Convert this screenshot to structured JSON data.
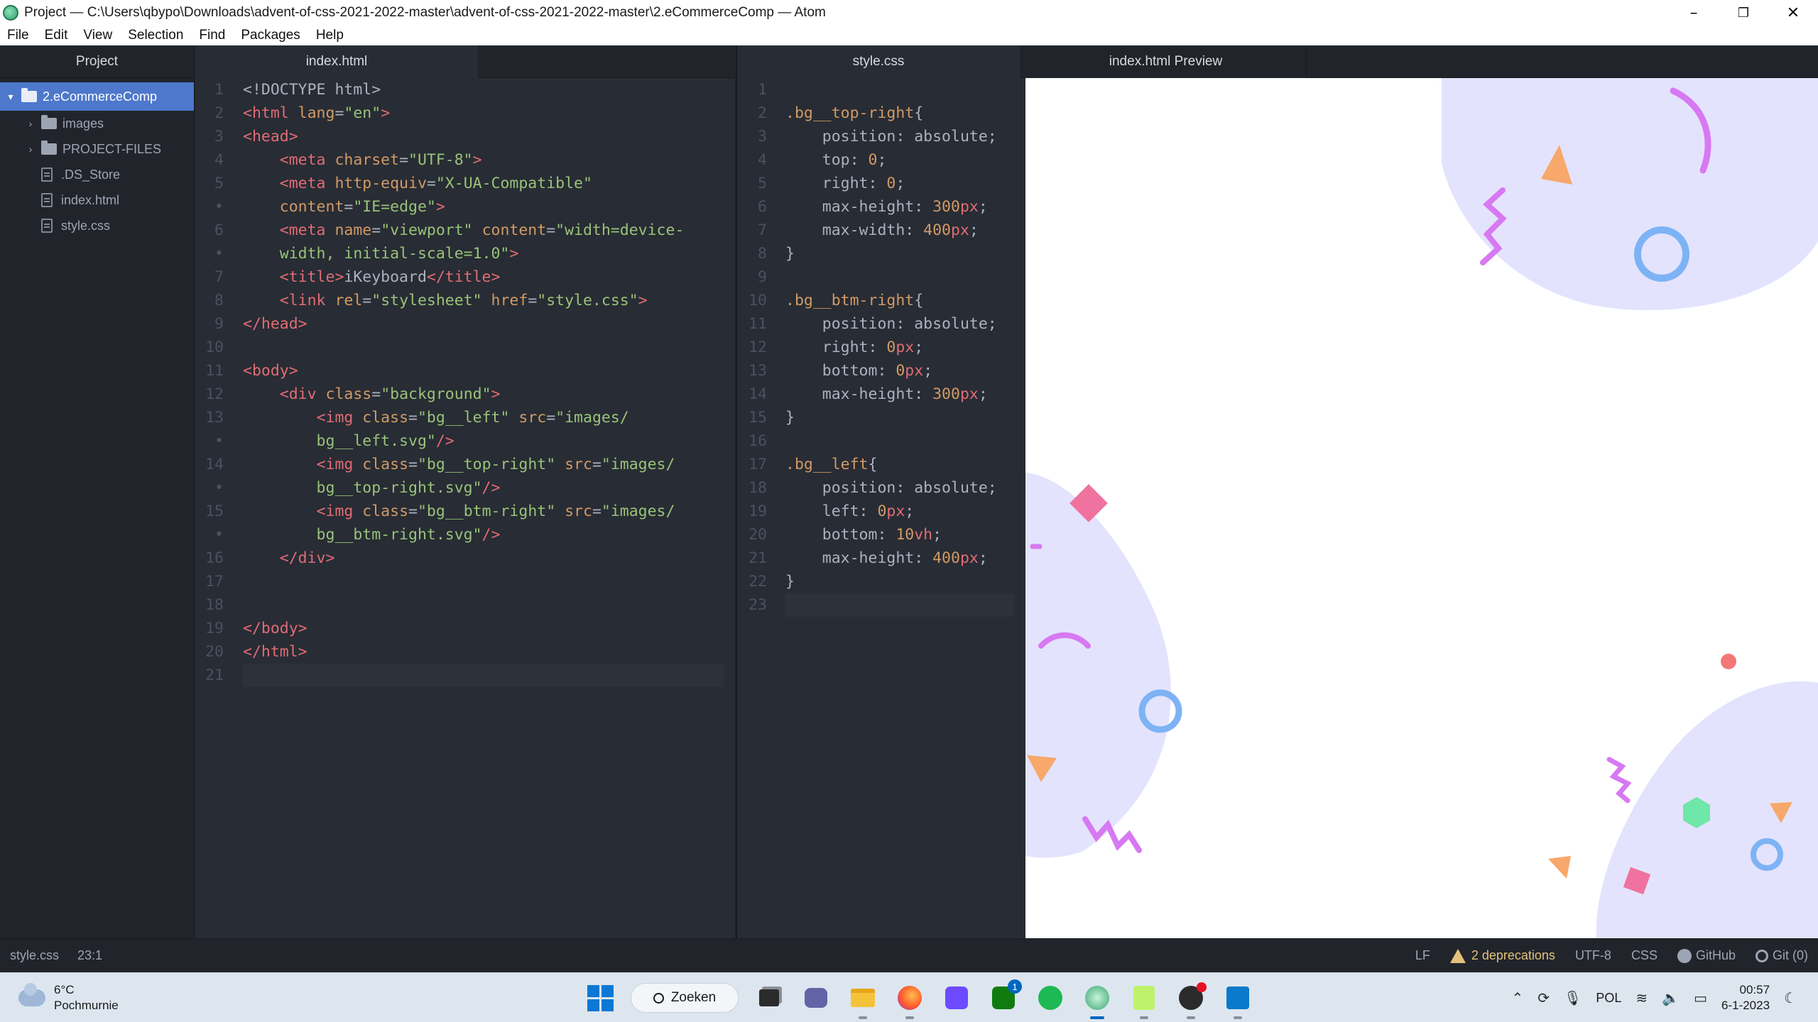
{
  "window": {
    "title": "Project — C:\\Users\\qbypo\\Downloads\\advent-of-css-2021-2022-master\\advent-of-css-2021-2022-master\\2.eCommerceComp — Atom",
    "controls": {
      "minimize": "–",
      "maximize": "❐",
      "close": "✕"
    }
  },
  "menu": [
    "File",
    "Edit",
    "View",
    "Selection",
    "Find",
    "Packages",
    "Help"
  ],
  "tree": {
    "header": "Project",
    "root": "2.eCommerceComp",
    "folders": [
      "images",
      "PROJECT-FILES"
    ],
    "files": [
      ".DS_Store",
      "index.html",
      "style.css"
    ]
  },
  "tabs": {
    "left": "index.html",
    "middle": "style.css",
    "right": "index.html Preview"
  },
  "html_lines": [
    {
      "n": "1",
      "segs": [
        [
          "pl",
          "<!DOCTYPE html>"
        ]
      ]
    },
    {
      "n": "2",
      "segs": [
        [
          "tg",
          "<html "
        ],
        [
          "at",
          "lang"
        ],
        [
          "pl",
          "="
        ],
        [
          "st",
          "\"en\""
        ],
        [
          "tg",
          ">"
        ]
      ]
    },
    {
      "n": "3",
      "segs": [
        [
          "tg",
          "<head>"
        ]
      ]
    },
    {
      "n": "4",
      "segs": [
        [
          "pl",
          "    "
        ],
        [
          "tg",
          "<meta "
        ],
        [
          "at",
          "charset"
        ],
        [
          "pl",
          "="
        ],
        [
          "st",
          "\"UTF-8\""
        ],
        [
          "tg",
          ">"
        ]
      ]
    },
    {
      "n": "5",
      "segs": [
        [
          "pl",
          "    "
        ],
        [
          "tg",
          "<meta "
        ],
        [
          "at",
          "http-equiv"
        ],
        [
          "pl",
          "="
        ],
        [
          "st",
          "\"X-UA-Compatible\""
        ]
      ]
    },
    {
      "n": "•",
      "segs": [
        [
          "pl",
          "    "
        ],
        [
          "at",
          "content"
        ],
        [
          "pl",
          "="
        ],
        [
          "st",
          "\"IE=edge\""
        ],
        [
          "tg",
          ">"
        ]
      ]
    },
    {
      "n": "6",
      "segs": [
        [
          "pl",
          "    "
        ],
        [
          "tg",
          "<meta "
        ],
        [
          "at",
          "name"
        ],
        [
          "pl",
          "="
        ],
        [
          "st",
          "\"viewport\" "
        ],
        [
          "at",
          "content"
        ],
        [
          "pl",
          "="
        ],
        [
          "st",
          "\"width=device-"
        ]
      ]
    },
    {
      "n": "•",
      "segs": [
        [
          "st",
          "    width, initial-scale=1.0\""
        ],
        [
          "tg",
          ">"
        ]
      ]
    },
    {
      "n": "7",
      "segs": [
        [
          "pl",
          "    "
        ],
        [
          "tg",
          "<title>"
        ],
        [
          "pl",
          "iKeyboard"
        ],
        [
          "tg",
          "</title>"
        ]
      ]
    },
    {
      "n": "8",
      "segs": [
        [
          "pl",
          "    "
        ],
        [
          "tg",
          "<link "
        ],
        [
          "at",
          "rel"
        ],
        [
          "pl",
          "="
        ],
        [
          "st",
          "\"stylesheet\" "
        ],
        [
          "at",
          "href"
        ],
        [
          "pl",
          "="
        ],
        [
          "st",
          "\"style.css\""
        ],
        [
          "tg",
          ">"
        ]
      ]
    },
    {
      "n": "9",
      "segs": [
        [
          "tg",
          "</head>"
        ]
      ]
    },
    {
      "n": "10",
      "segs": []
    },
    {
      "n": "11",
      "segs": [
        [
          "tg",
          "<body>"
        ]
      ]
    },
    {
      "n": "12",
      "segs": [
        [
          "pl",
          "    "
        ],
        [
          "tg",
          "<div "
        ],
        [
          "at",
          "class"
        ],
        [
          "pl",
          "="
        ],
        [
          "st",
          "\"background\""
        ],
        [
          "tg",
          ">"
        ]
      ]
    },
    {
      "n": "13",
      "segs": [
        [
          "pl",
          "        "
        ],
        [
          "tg",
          "<img "
        ],
        [
          "at",
          "class"
        ],
        [
          "pl",
          "="
        ],
        [
          "st",
          "\"bg__left\" "
        ],
        [
          "at",
          "src"
        ],
        [
          "pl",
          "="
        ],
        [
          "st",
          "\"images/"
        ]
      ]
    },
    {
      "n": "•",
      "segs": [
        [
          "st",
          "        bg__left.svg\""
        ],
        [
          "tg",
          "/>"
        ]
      ]
    },
    {
      "n": "14",
      "segs": [
        [
          "pl",
          "        "
        ],
        [
          "tg",
          "<img "
        ],
        [
          "at",
          "class"
        ],
        [
          "pl",
          "="
        ],
        [
          "st",
          "\"bg__top-right\" "
        ],
        [
          "at",
          "src"
        ],
        [
          "pl",
          "="
        ],
        [
          "st",
          "\"images/"
        ]
      ]
    },
    {
      "n": "•",
      "segs": [
        [
          "st",
          "        bg__top-right.svg\""
        ],
        [
          "tg",
          "/>"
        ]
      ]
    },
    {
      "n": "15",
      "segs": [
        [
          "pl",
          "        "
        ],
        [
          "tg",
          "<img "
        ],
        [
          "at",
          "class"
        ],
        [
          "pl",
          "="
        ],
        [
          "st",
          "\"bg__btm-right\" "
        ],
        [
          "at",
          "src"
        ],
        [
          "pl",
          "="
        ],
        [
          "st",
          "\"images/"
        ]
      ]
    },
    {
      "n": "•",
      "segs": [
        [
          "st",
          "        bg__btm-right.svg\""
        ],
        [
          "tg",
          "/>"
        ]
      ]
    },
    {
      "n": "16",
      "segs": [
        [
          "pl",
          "    "
        ],
        [
          "tg",
          "</div>"
        ]
      ]
    },
    {
      "n": "17",
      "segs": []
    },
    {
      "n": "18",
      "segs": []
    },
    {
      "n": "19",
      "segs": [
        [
          "tg",
          "</body>"
        ]
      ]
    },
    {
      "n": "20",
      "segs": [
        [
          "tg",
          "</html>"
        ]
      ]
    },
    {
      "n": "21",
      "segs": [],
      "cursor": true
    }
  ],
  "css_lines": [
    {
      "n": "1",
      "segs": []
    },
    {
      "n": "2",
      "segs": [
        [
          "sel",
          ".bg__top-right"
        ],
        [
          "pl",
          "{"
        ]
      ]
    },
    {
      "n": "3",
      "segs": [
        [
          "pr",
          "    position: absolute;"
        ]
      ]
    },
    {
      "n": "4",
      "segs": [
        [
          "pr",
          "    top: "
        ],
        [
          "nm",
          "0"
        ],
        [
          "pl",
          ";"
        ]
      ]
    },
    {
      "n": "5",
      "segs": [
        [
          "pr",
          "    right: "
        ],
        [
          "nm",
          "0"
        ],
        [
          "pl",
          ";"
        ]
      ]
    },
    {
      "n": "6",
      "segs": [
        [
          "pr",
          "    max-height: "
        ],
        [
          "nm",
          "300"
        ],
        [
          "un",
          "px"
        ],
        [
          "pl",
          ";"
        ]
      ]
    },
    {
      "n": "7",
      "segs": [
        [
          "pr",
          "    max-width: "
        ],
        [
          "nm",
          "400"
        ],
        [
          "un",
          "px"
        ],
        [
          "pl",
          ";"
        ]
      ]
    },
    {
      "n": "8",
      "segs": [
        [
          "pl",
          "}"
        ]
      ]
    },
    {
      "n": "9",
      "segs": []
    },
    {
      "n": "10",
      "segs": [
        [
          "sel",
          ".bg__btm-right"
        ],
        [
          "pl",
          "{"
        ]
      ]
    },
    {
      "n": "11",
      "segs": [
        [
          "pr",
          "    position: absolute;"
        ]
      ]
    },
    {
      "n": "12",
      "segs": [
        [
          "pr",
          "    right: "
        ],
        [
          "nm",
          "0"
        ],
        [
          "un",
          "px"
        ],
        [
          "pl",
          ";"
        ]
      ]
    },
    {
      "n": "13",
      "segs": [
        [
          "pr",
          "    bottom: "
        ],
        [
          "nm",
          "0"
        ],
        [
          "un",
          "px"
        ],
        [
          "pl",
          ";"
        ]
      ]
    },
    {
      "n": "14",
      "segs": [
        [
          "pr",
          "    max-height: "
        ],
        [
          "nm",
          "300"
        ],
        [
          "un",
          "px"
        ],
        [
          "pl",
          ";"
        ]
      ]
    },
    {
      "n": "15",
      "segs": [
        [
          "pl",
          "}"
        ]
      ]
    },
    {
      "n": "16",
      "segs": []
    },
    {
      "n": "17",
      "segs": [
        [
          "sel",
          ".bg__left"
        ],
        [
          "pl",
          "{"
        ]
      ]
    },
    {
      "n": "18",
      "segs": [
        [
          "pr",
          "    position: absolute;"
        ]
      ]
    },
    {
      "n": "19",
      "segs": [
        [
          "pr",
          "    left: "
        ],
        [
          "nm",
          "0"
        ],
        [
          "un",
          "px"
        ],
        [
          "pl",
          ";"
        ]
      ]
    },
    {
      "n": "20",
      "segs": [
        [
          "pr",
          "    bottom: "
        ],
        [
          "nm",
          "10"
        ],
        [
          "un",
          "vh"
        ],
        [
          "pl",
          ";"
        ]
      ]
    },
    {
      "n": "21",
      "segs": [
        [
          "pr",
          "    max-height: "
        ],
        [
          "nm",
          "400"
        ],
        [
          "un",
          "px"
        ],
        [
          "pl",
          ";"
        ]
      ]
    },
    {
      "n": "22",
      "segs": [
        [
          "pl",
          "}"
        ]
      ]
    },
    {
      "n": "23",
      "segs": [],
      "cursor": true
    }
  ],
  "colors": {
    "tag": "#e06c75",
    "attr": "#d19a66",
    "string": "#98c379",
    "plain": "#abb2bf",
    "blob": "#e4e3fd",
    "accent_blue": "#4d78cc"
  },
  "status": {
    "file": "style.css",
    "position": "23:1",
    "line_ending": "LF",
    "deprecations": "2 deprecations",
    "encoding": "UTF-8",
    "grammar": "CSS",
    "github": "GitHub",
    "git": "Git (0)"
  },
  "taskbar": {
    "weather_temp": "6°C",
    "weather_desc": "Pochmurnie",
    "search": "Zoeken",
    "xbox_badge": "1",
    "language": "POL",
    "time": "00:57",
    "date": "6-1-2023",
    "apps": [
      "start-icon",
      "task-view-icon",
      "teams-chat-icon",
      "file-explorer-icon",
      "firefox-icon",
      "proton-icon",
      "xbox-icon",
      "spotify-icon",
      "atom-icon",
      "notepad-icon",
      "obs-icon",
      "vscode-icon"
    ]
  }
}
